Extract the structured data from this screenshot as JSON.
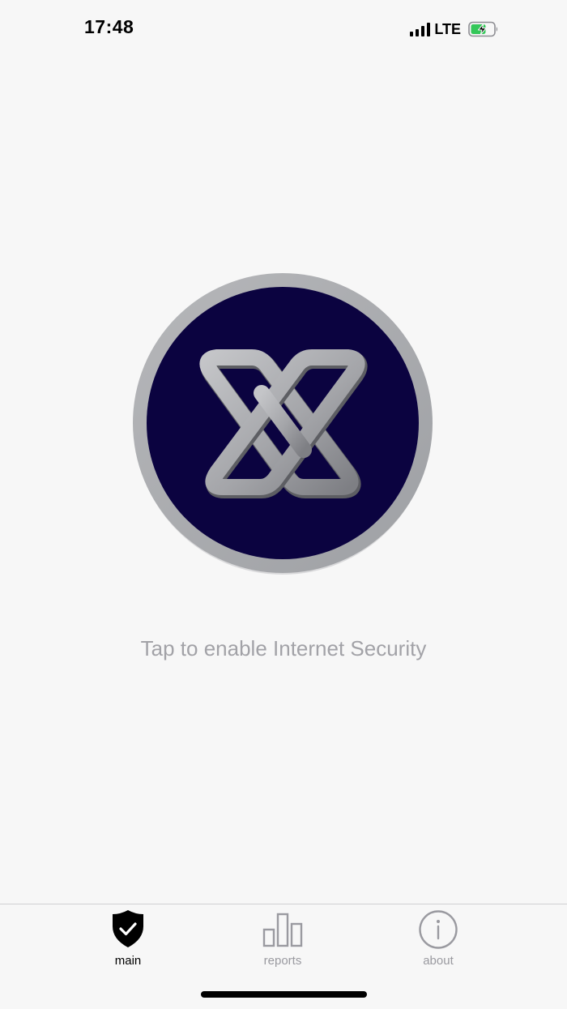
{
  "status_bar": {
    "time": "17:48",
    "network": "LTE",
    "signal_icon": "cellular-signal-icon",
    "battery_icon": "battery-charging-icon",
    "battery_color": "#34c759"
  },
  "main": {
    "logo_icon": "x-logo-icon",
    "logo_bg_color": "#0b0340",
    "ring_color": "#a9aaad",
    "hint": "Tap to enable Internet Security"
  },
  "tab_bar": {
    "tabs": [
      {
        "label": "main",
        "icon": "shield-check-icon",
        "active": true
      },
      {
        "label": "reports",
        "icon": "bar-chart-icon",
        "active": false
      },
      {
        "label": "about",
        "icon": "info-icon",
        "active": false
      }
    ]
  }
}
